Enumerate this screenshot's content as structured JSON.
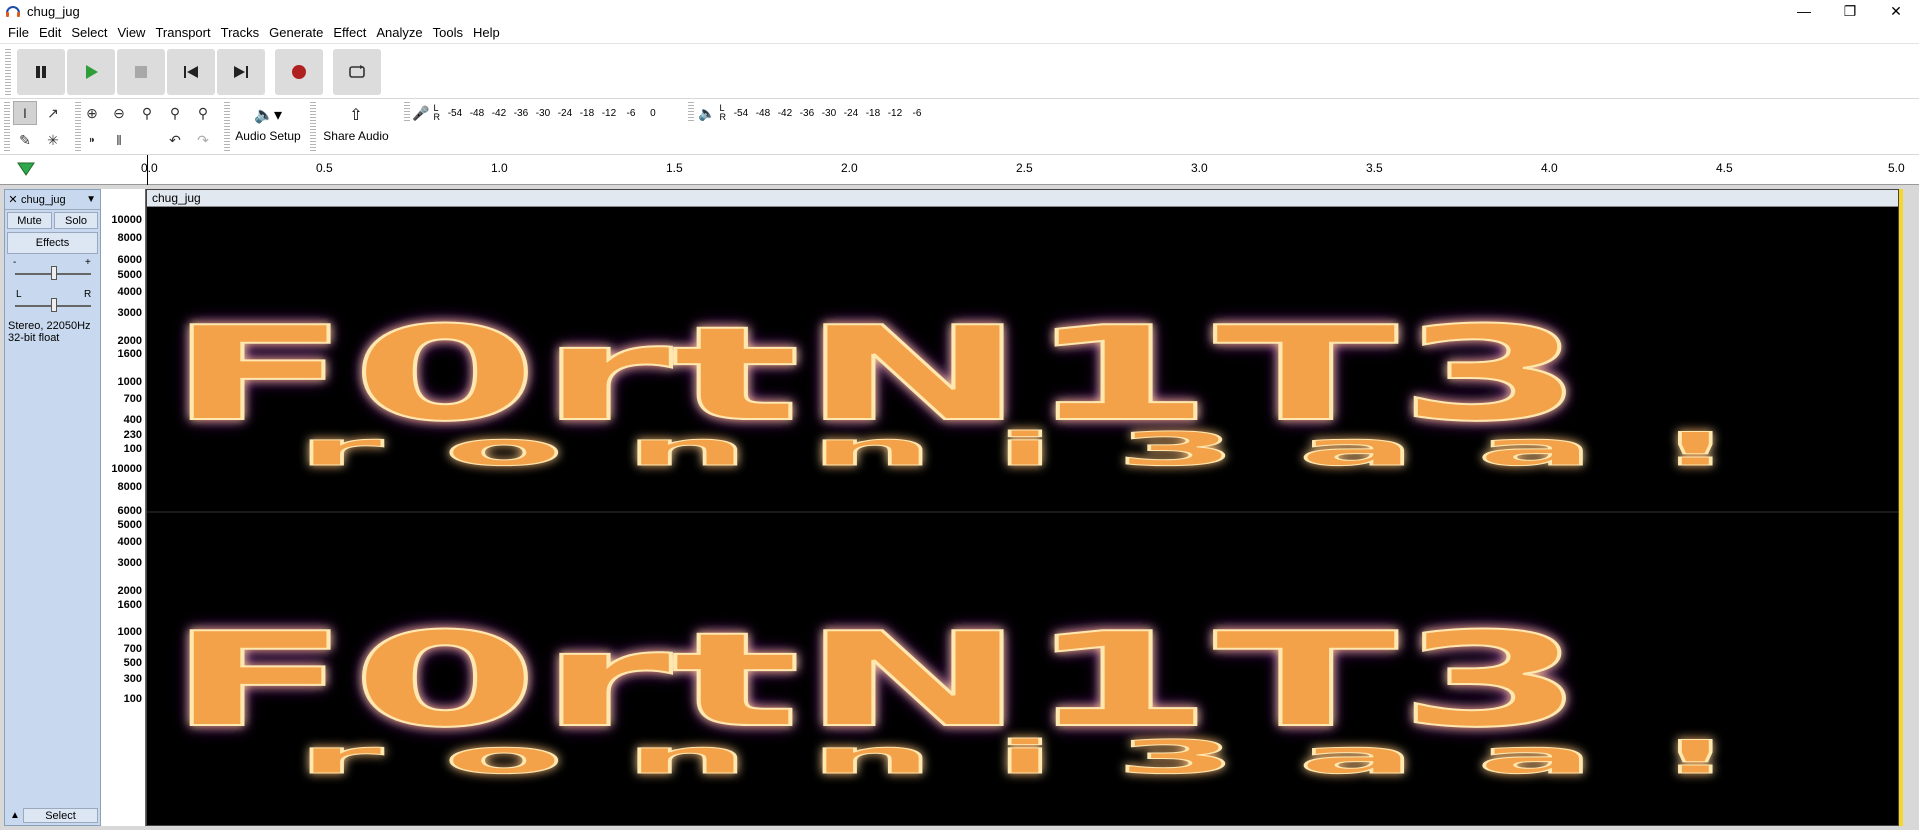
{
  "window": {
    "title": "chug_jug",
    "controls": [
      "minimize",
      "maximize",
      "close"
    ]
  },
  "menu": [
    "File",
    "Edit",
    "Select",
    "View",
    "Transport",
    "Tracks",
    "Generate",
    "Effect",
    "Analyze",
    "Tools",
    "Help"
  ],
  "transport": {
    "buttons": [
      "pause",
      "play",
      "stop",
      "skip-to-start",
      "skip-to-end",
      "record",
      "loop"
    ]
  },
  "tools": {
    "audio_setup_label": "Audio Setup",
    "share_audio_label": "Share Audio"
  },
  "meters": {
    "record_ticks": [
      "-54",
      "-48",
      "-42",
      "-36",
      "-30",
      "-24",
      "-18",
      "-12",
      "-6",
      "0"
    ],
    "play_ticks": [
      "-54",
      "-48",
      "-42",
      "-36",
      "-30",
      "-24",
      "-18",
      "-12",
      "-6"
    ],
    "lr_left": "L",
    "lr_right": "R"
  },
  "ruler": {
    "ticks": [
      "0.0",
      "0.5",
      "1.0",
      "1.5",
      "2.0",
      "2.5",
      "3.0",
      "3.5",
      "4.0",
      "4.5",
      "5.0"
    ]
  },
  "track": {
    "name": "chug_jug",
    "mute_label": "Mute",
    "solo_label": "Solo",
    "effects_label": "Effects",
    "gain_minus": "-",
    "gain_plus": "+",
    "pan_left": "L",
    "pan_right": "R",
    "info_line1": "Stereo, 22050Hz",
    "info_line2": "32-bit float",
    "select_label": "Select",
    "clip_name": "chug_jug",
    "freq_labels_top": [
      "10000",
      "8000",
      "6000",
      "5000",
      "4000",
      "3000",
      "2000",
      "1600",
      "1000",
      "700",
      "400",
      "230",
      "100"
    ],
    "freq_labels_bottom": [
      "10000",
      "8000",
      "6000",
      "5000",
      "4000",
      "3000",
      "2000",
      "1600",
      "1000",
      "700",
      "500",
      "300",
      "100"
    ],
    "spectrogram_text_main": "F0rtN1T3",
    "spectrogram_text_sub": "r o n n i 3 a a !"
  },
  "colors": {
    "accent": "#c8d9ef",
    "spectrogram_bg": "#000000",
    "selection_edge": "#f5d72c"
  }
}
